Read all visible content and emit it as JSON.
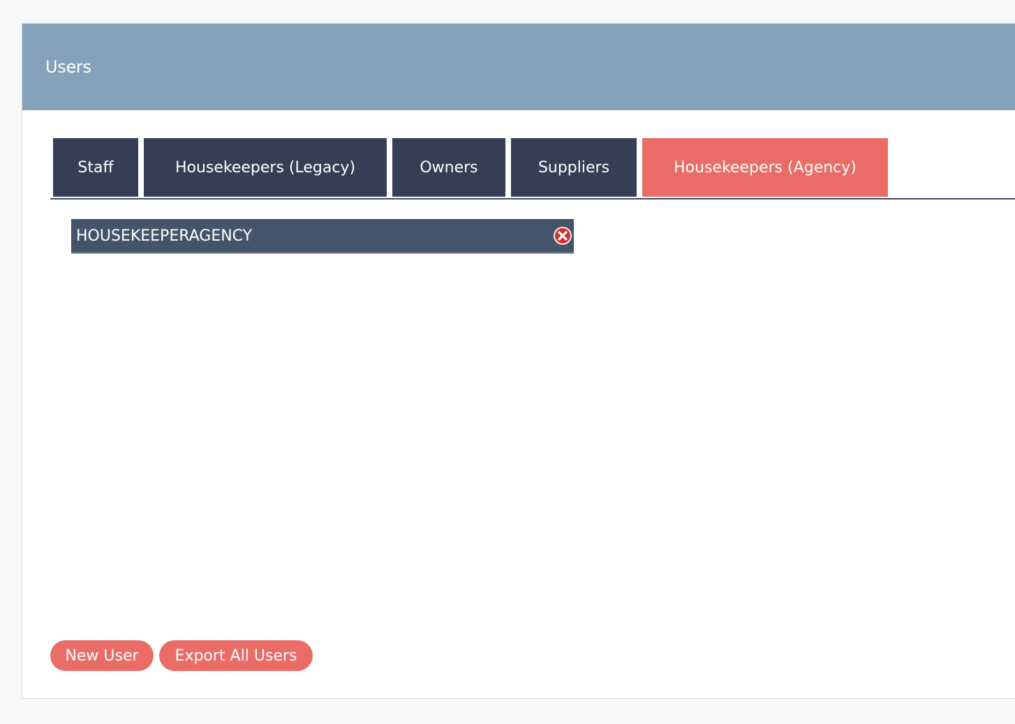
{
  "header": {
    "title": "Users"
  },
  "tabs": [
    {
      "label": "Staff",
      "active": false
    },
    {
      "label": "Housekeepers (Legacy)",
      "active": false
    },
    {
      "label": "Owners",
      "active": false
    },
    {
      "label": "Suppliers",
      "active": false
    },
    {
      "label": "Housekeepers (Agency)",
      "active": true
    }
  ],
  "users": [
    {
      "name": "HOUSEKEEPERAGENCY",
      "remove_icon": "remove-circle-icon"
    }
  ],
  "actions": {
    "new_user_label": "New User",
    "export_label": "Export All Users"
  },
  "colors": {
    "header_bg": "#85a1b9",
    "tab_bg": "#343f56",
    "accent": "#ea6c66",
    "item_bg": "#44546b"
  }
}
